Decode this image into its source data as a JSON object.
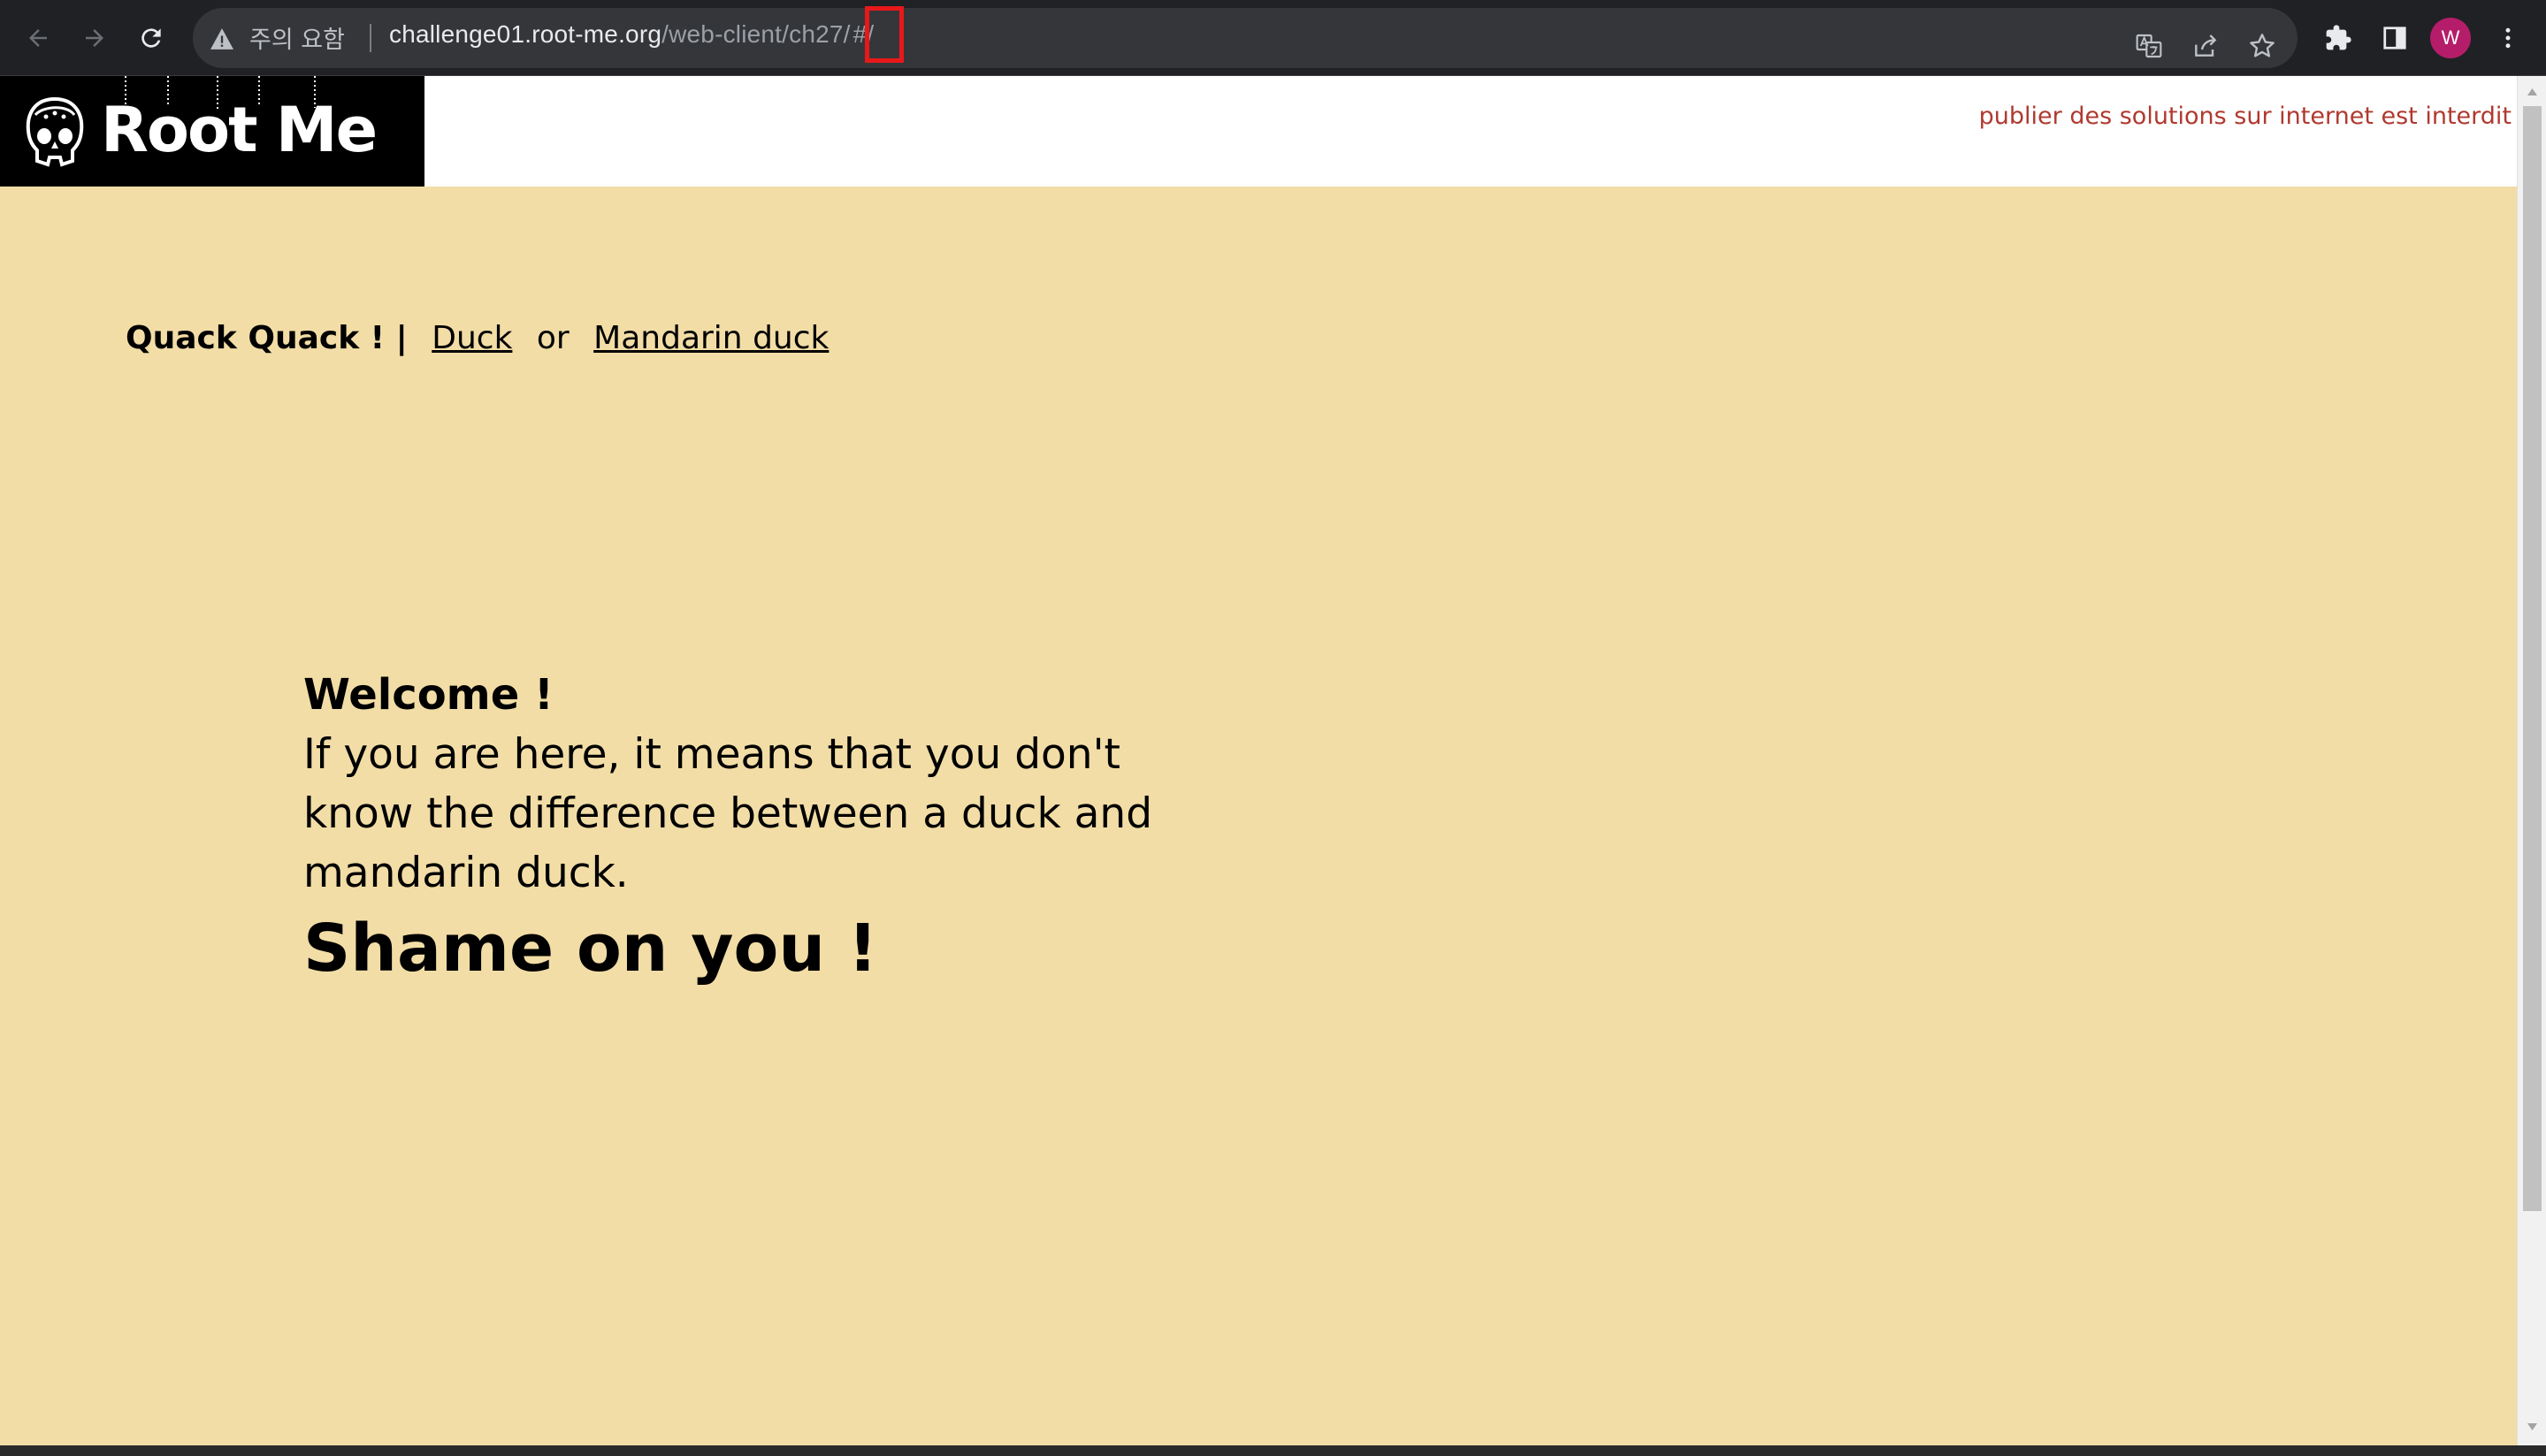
{
  "browser": {
    "security_label": "주의 요함",
    "url_host": "challenge01.root-me.org",
    "url_path": "/web-client/ch27/",
    "url_hash": "#/",
    "avatar_initial": "W",
    "icons": [
      "back-icon",
      "forward-icon",
      "reload-icon",
      "warning-icon",
      "translate-icon",
      "share-icon",
      "star-icon",
      "extensions-icon",
      "side-panel-icon",
      "menu-icon"
    ]
  },
  "header": {
    "logo_text": "Root Me",
    "notice": "publier des solutions sur internet est interdit"
  },
  "nav": {
    "brand": "Quack Quack ! |",
    "link_duck": "Duck",
    "separator": "or",
    "link_mandarin": "Mandarin duck"
  },
  "main": {
    "welcome_title": "Welcome !",
    "welcome_body": "If you are here, it means that you don't know the difference between a duck and mandarin duck.",
    "shame": "Shame on you !"
  },
  "colors": {
    "page_bg": "#f2dda6",
    "chrome_bg": "#202124",
    "notice": "#b0392f",
    "highlight": "#e8181a",
    "avatar": "#b51d6a"
  }
}
